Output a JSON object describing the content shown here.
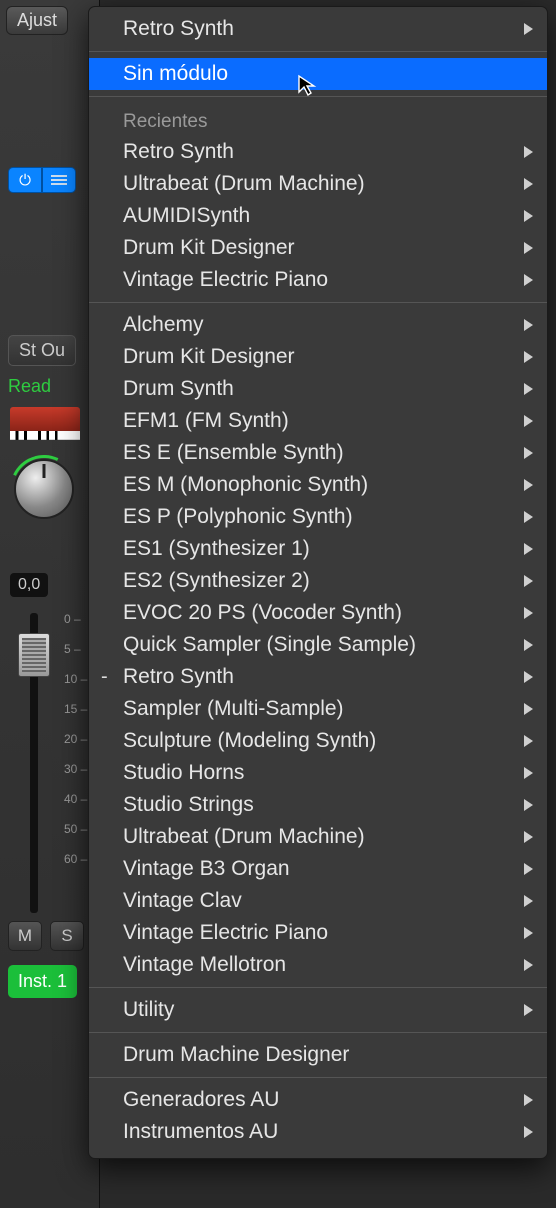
{
  "strip": {
    "settings_btn": "Ajust",
    "output_btn": "St Ou",
    "read_label": "Read",
    "value": "0,0",
    "mute": "M",
    "solo": "S",
    "inst_btn": "Inst. 1",
    "ticks": [
      "0",
      "5",
      "10",
      "15",
      "20",
      "30",
      "40",
      "50",
      "60"
    ]
  },
  "menu": {
    "top": {
      "label": "Retro Synth"
    },
    "no_plugin": "Sin módulo",
    "recents_header": "Recientes",
    "recents": [
      "Retro Synth",
      "Ultrabeat (Drum Machine)",
      "AUMIDISynth",
      "Drum Kit Designer",
      "Vintage Electric Piano"
    ],
    "instruments": [
      {
        "label": "Alchemy",
        "sub": true
      },
      {
        "label": "Drum Kit Designer",
        "sub": true
      },
      {
        "label": "Drum Synth",
        "sub": true
      },
      {
        "label": "EFM1  (FM Synth)",
        "sub": true
      },
      {
        "label": "ES E  (Ensemble Synth)",
        "sub": true
      },
      {
        "label": "ES M  (Monophonic Synth)",
        "sub": true
      },
      {
        "label": "ES P  (Polyphonic Synth)",
        "sub": true
      },
      {
        "label": "ES1  (Synthesizer 1)",
        "sub": true
      },
      {
        "label": "ES2  (Synthesizer 2)",
        "sub": true
      },
      {
        "label": "EVOC 20 PS  (Vocoder Synth)",
        "sub": true
      },
      {
        "label": "Quick Sampler (Single Sample)",
        "sub": true
      },
      {
        "label": "Retro Synth",
        "sub": true,
        "current": true
      },
      {
        "label": "Sampler (Multi-Sample)",
        "sub": true
      },
      {
        "label": "Sculpture  (Modeling Synth)",
        "sub": true
      },
      {
        "label": "Studio Horns",
        "sub": true
      },
      {
        "label": "Studio Strings",
        "sub": true
      },
      {
        "label": "Ultrabeat (Drum Machine)",
        "sub": true
      },
      {
        "label": "Vintage B3 Organ",
        "sub": true
      },
      {
        "label": "Vintage Clav",
        "sub": true
      },
      {
        "label": "Vintage Electric Piano",
        "sub": true
      },
      {
        "label": "Vintage Mellotron",
        "sub": true
      }
    ],
    "utility": "Utility",
    "dmd": "Drum Machine Designer",
    "au_gen": "Generadores AU",
    "au_inst": "Instrumentos AU"
  }
}
